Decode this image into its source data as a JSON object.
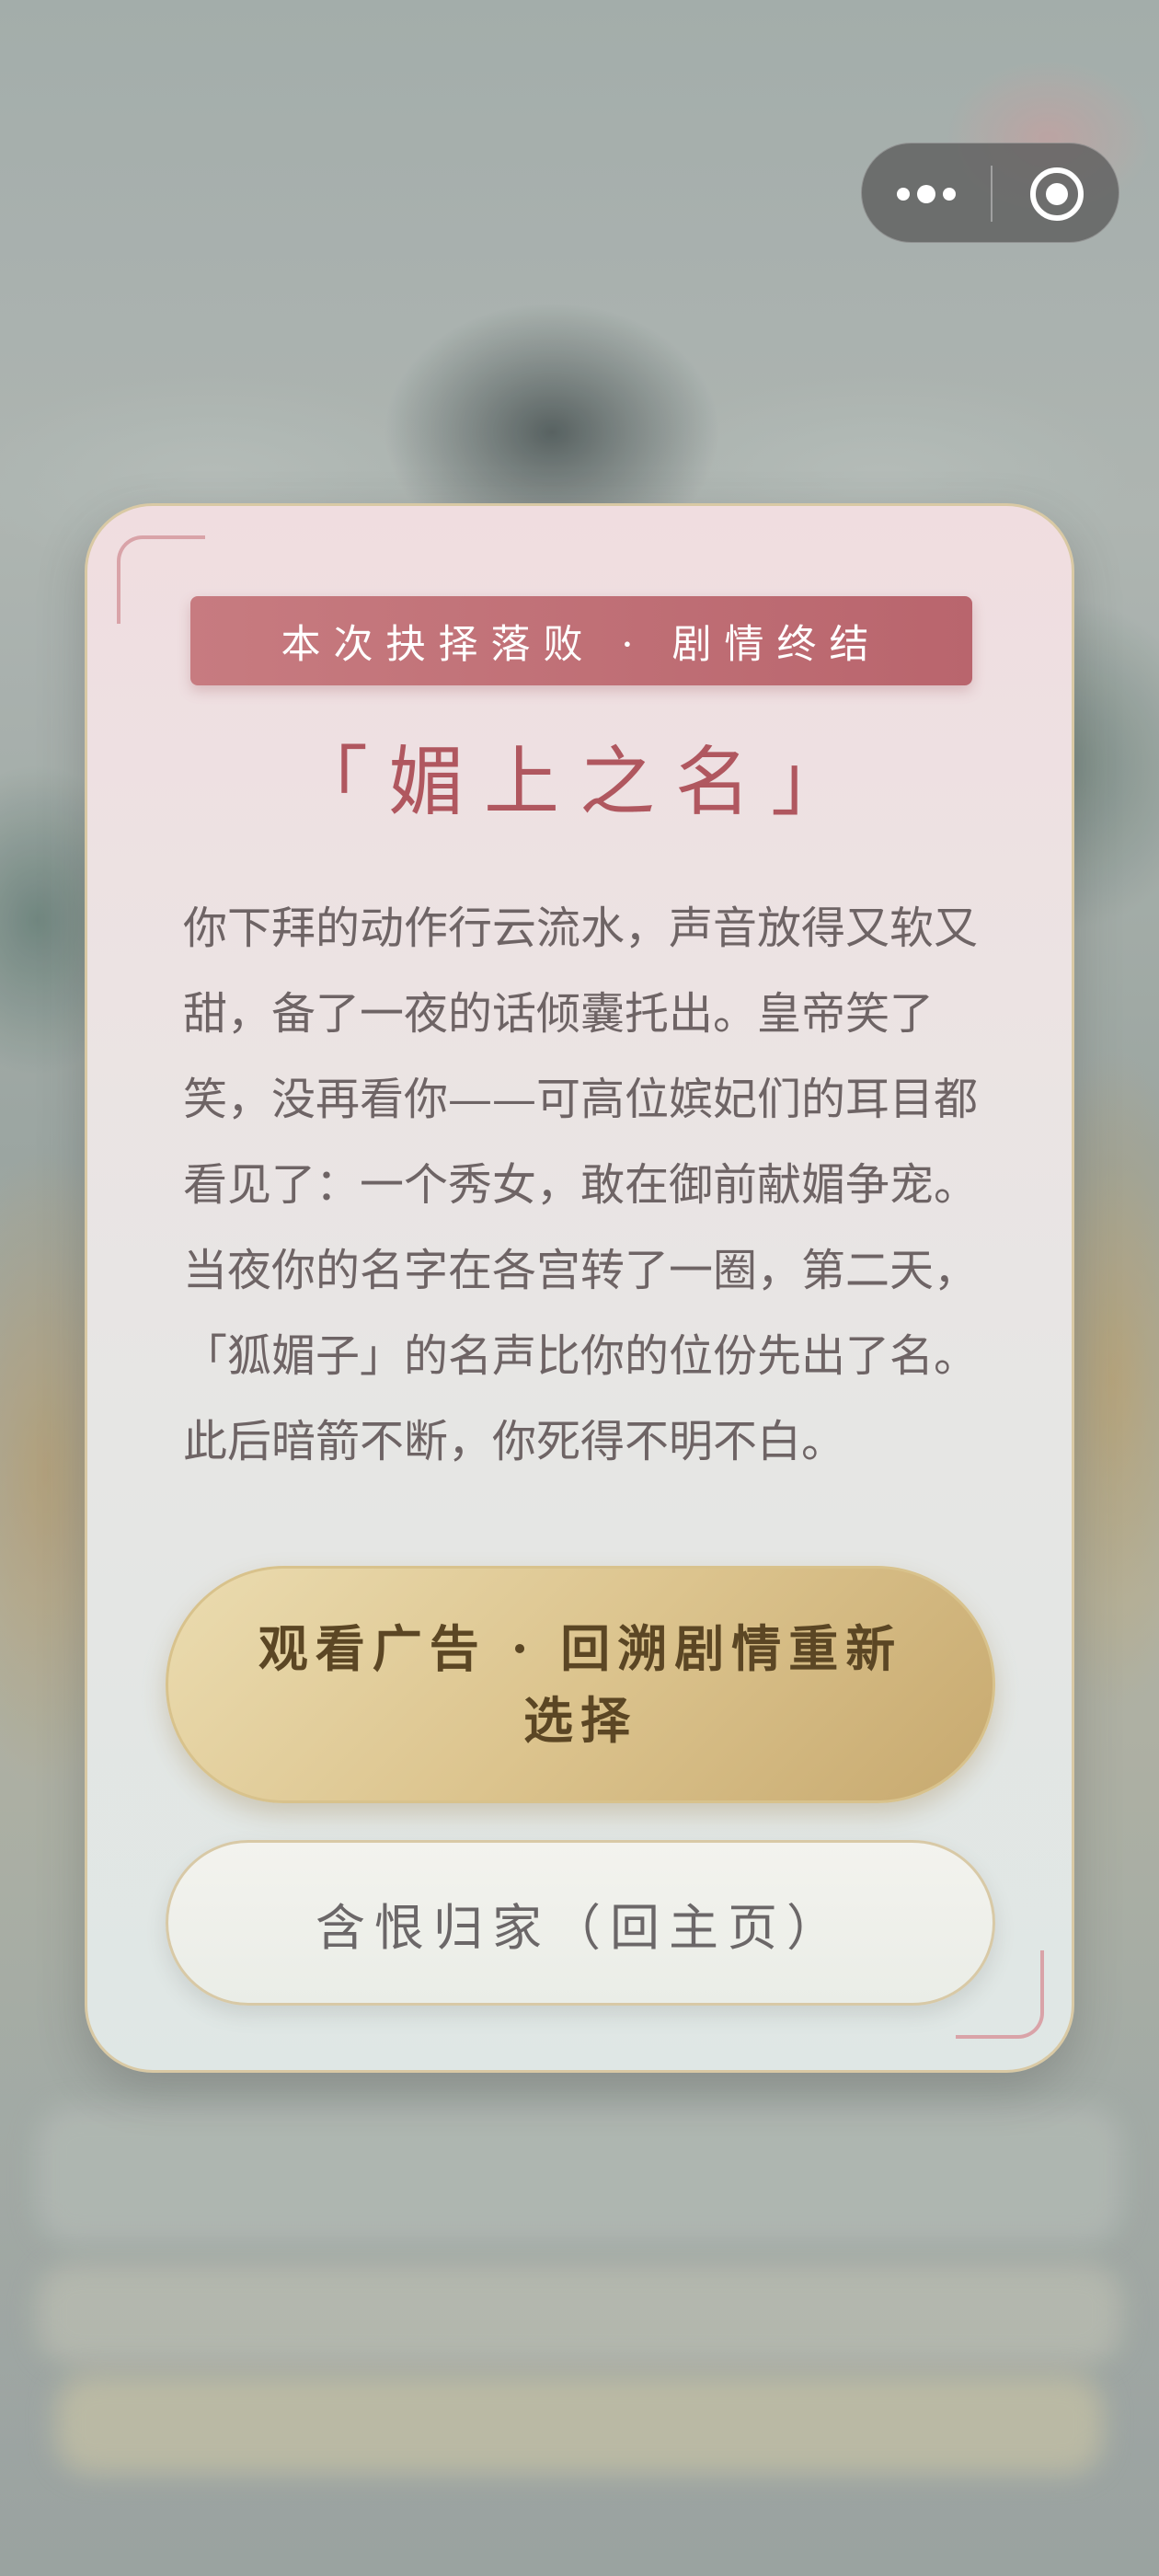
{
  "capsule": {
    "more_icon": "more-dots-icon",
    "close_icon": "target-circle-icon"
  },
  "modal": {
    "banner": "本次抉择落败 · 剧情终结",
    "title": "「媚上之名」",
    "body_lines": [
      "你下拜的动作行云流水，声音放得又软又",
      "甜，备了一夜的话倾囊托出。皇帝笑了",
      "笑，没再看你——可高位嫔妃们的耳目都",
      "看见了：一个秀女，敢在御前献媚争宠。",
      "当夜你的名字在各宫转了一圈，第二天，",
      "「狐媚子」的名声比你的位份先出了名。",
      "此后暗箭不断，你死得不明不白。"
    ],
    "primary_button": "观看广告 · 回溯剧情重新选择",
    "secondary_button": "含恨归家（回主页）"
  },
  "colors": {
    "banner": "#c06f76",
    "title": "#b0575f",
    "primary_button": "#dcc48e",
    "primary_button_text": "#5b4624",
    "card_border": "#d9c9a4",
    "corner_accent": "#d9a3a8"
  }
}
